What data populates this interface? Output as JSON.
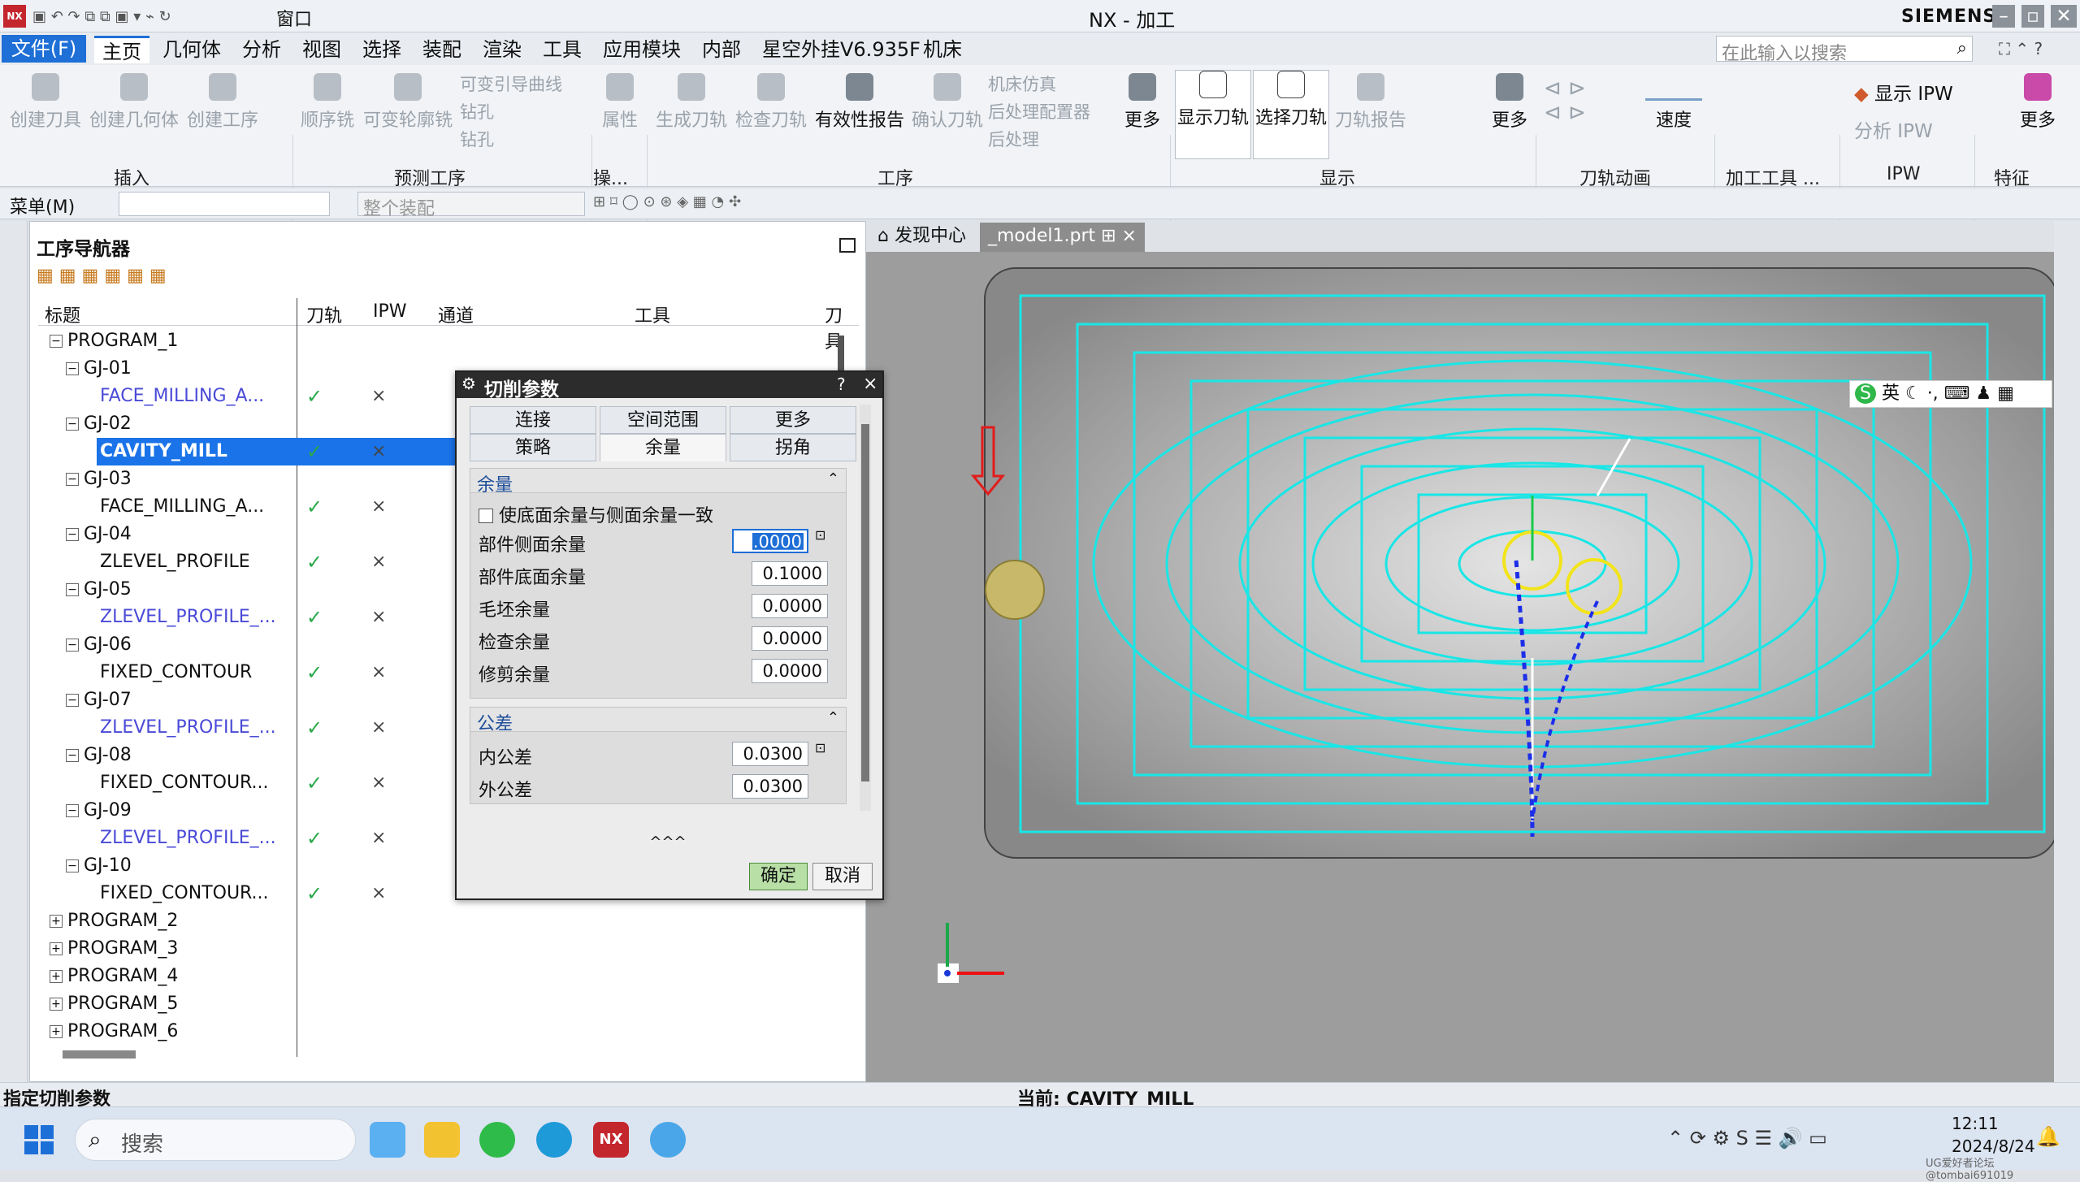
{
  "window": {
    "title": "NX - 加工",
    "brand": "SIEMENS",
    "app_badge": "NX",
    "window_menu": "窗口"
  },
  "menu": {
    "file": "文件(F)",
    "tabs": [
      "主页",
      "几何体",
      "分析",
      "视图",
      "选择",
      "装配",
      "渲染",
      "工具",
      "应用模块",
      "内部",
      "星空外挂V6.935F",
      "机床"
    ],
    "active_tab": "主页",
    "search_placeholder": "在此输入以搜索"
  },
  "ribbon": {
    "insert": {
      "buttons": [
        "创建刀具",
        "创建几何体",
        "创建工序"
      ],
      "group": "插入"
    },
    "pre": {
      "buttons": [
        "顺序铣",
        "可变轮廓铣"
      ],
      "small": [
        "可变引导曲线",
        "钻孔",
        "钻孔"
      ],
      "group": "预测工序"
    },
    "ops": {
      "attr": "属性",
      "group": "操..."
    },
    "procedure": {
      "buttons": [
        "生成刀轨",
        "检查刀轨",
        "有效性报告",
        "确认刀轨"
      ],
      "small": [
        "机床仿真",
        "后处理配置器",
        "后处理"
      ],
      "more": "更多",
      "group": "工序"
    },
    "display": {
      "buttons": [
        "显示刀轨",
        "选择刀轨",
        "刀轨报告"
      ],
      "more": "更多",
      "group": "显示"
    },
    "anim": {
      "speed": "速度",
      "group": "刀轨动画"
    },
    "tools": {
      "group": "加工工具 ..."
    },
    "ipw": {
      "show": "显示 IPW",
      "analyze": "分析 IPW",
      "group": "IPW"
    },
    "feature": {
      "more": "更多",
      "group": "特征"
    }
  },
  "cmdbar": {
    "menu": "菜单(M)",
    "filter": "整个装配"
  },
  "navigator": {
    "title": "工序导航器",
    "columns": [
      "标题",
      "刀轨",
      "IPW",
      "通道",
      "工具",
      "刀具"
    ],
    "rows": [
      {
        "label": "PROGRAM_1",
        "level": 0,
        "exp": "−",
        "tick": "",
        "x": ""
      },
      {
        "label": "GJ-01",
        "level": 1,
        "exp": "−",
        "tick": "",
        "x": ""
      },
      {
        "label": "FACE_MILLING_A...",
        "level": 2,
        "exp": "",
        "tick": "✓",
        "x": "×",
        "link": true
      },
      {
        "label": "GJ-02",
        "level": 1,
        "exp": "−",
        "tick": "",
        "x": ""
      },
      {
        "label": "CAVITY_MILL",
        "level": 2,
        "exp": "",
        "tick": "✓",
        "x": "×",
        "selected": true
      },
      {
        "label": "GJ-03",
        "level": 1,
        "exp": "−",
        "tick": "",
        "x": ""
      },
      {
        "label": "FACE_MILLING_A...",
        "level": 2,
        "exp": "",
        "tick": "✓",
        "x": "×"
      },
      {
        "label": "GJ-04",
        "level": 1,
        "exp": "−",
        "tick": "",
        "x": ""
      },
      {
        "label": "ZLEVEL_PROFILE",
        "level": 2,
        "exp": "",
        "tick": "✓",
        "x": "×"
      },
      {
        "label": "GJ-05",
        "level": 1,
        "exp": "−",
        "tick": "",
        "x": ""
      },
      {
        "label": "ZLEVEL_PROFILE_...",
        "level": 2,
        "exp": "",
        "tick": "✓",
        "x": "×",
        "link": true
      },
      {
        "label": "GJ-06",
        "level": 1,
        "exp": "−",
        "tick": "",
        "x": ""
      },
      {
        "label": "FIXED_CONTOUR",
        "level": 2,
        "exp": "",
        "tick": "✓",
        "x": "×"
      },
      {
        "label": "GJ-07",
        "level": 1,
        "exp": "−",
        "tick": "",
        "x": ""
      },
      {
        "label": "ZLEVEL_PROFILE_...",
        "level": 2,
        "exp": "",
        "tick": "✓",
        "x": "×",
        "link": true
      },
      {
        "label": "GJ-08",
        "level": 1,
        "exp": "−",
        "tick": "",
        "x": ""
      },
      {
        "label": "FIXED_CONTOUR...",
        "level": 2,
        "exp": "",
        "tick": "✓",
        "x": "×"
      },
      {
        "label": "GJ-09",
        "level": 1,
        "exp": "−",
        "tick": "",
        "x": ""
      },
      {
        "label": "ZLEVEL_PROFILE_...",
        "level": 2,
        "exp": "",
        "tick": "✓",
        "x": "×",
        "link": true
      },
      {
        "label": "GJ-10",
        "level": 1,
        "exp": "−",
        "tick": "",
        "x": ""
      },
      {
        "label": "FIXED_CONTOUR...",
        "level": 2,
        "exp": "",
        "tick": "✓",
        "x": "×"
      },
      {
        "label": "PROGRAM_2",
        "level": 0,
        "exp": "+",
        "tick": "",
        "x": ""
      },
      {
        "label": "PROGRAM_3",
        "level": 0,
        "exp": "+",
        "tick": "",
        "x": ""
      },
      {
        "label": "PROGRAM_4",
        "level": 0,
        "exp": "+",
        "tick": "",
        "x": ""
      },
      {
        "label": "PROGRAM_5",
        "level": 0,
        "exp": "+",
        "tick": "",
        "x": ""
      },
      {
        "label": "PROGRAM_6",
        "level": 0,
        "exp": "+",
        "tick": "",
        "x": ""
      }
    ]
  },
  "viewport_tabs": {
    "discovery": "发现中心",
    "model": "_model1.prt"
  },
  "dialog": {
    "title": "切削参数",
    "help": "?",
    "tabs_row1": [
      "连接",
      "空间范围",
      "更多"
    ],
    "tabs_row2": [
      "策略",
      "余量",
      "拐角"
    ],
    "active_tab": "余量",
    "section_stock": "余量",
    "checkbox": "使底面余量与侧面余量一致",
    "fields": [
      {
        "label": "部件侧面余量",
        "value": "0.0000"
      },
      {
        "label": "部件底面余量",
        "value": "0.1000"
      },
      {
        "label": "毛坯余量",
        "value": "0.0000"
      },
      {
        "label": "检查余量",
        "value": "0.0000"
      },
      {
        "label": "修剪余量",
        "value": "0.0000"
      }
    ],
    "section_tol": "公差",
    "tol_fields": [
      {
        "label": "内公差",
        "value": "0.0300"
      },
      {
        "label": "外公差",
        "value": "0.0300"
      }
    ],
    "collapse": "^^^",
    "ok": "确定",
    "cancel": "取消"
  },
  "ime": {
    "lang": "英"
  },
  "status": {
    "left": "指定切削参数",
    "current": "当前: CAVITY_MILL"
  },
  "taskbar": {
    "search": "搜索",
    "time": "12:11",
    "date": "2024/8/24",
    "watermark": "UG爱好者论坛@tombai691019"
  },
  "colors": {
    "accent": "#1e6fd6",
    "selected": "#1a73e8",
    "toolpath": "#19e6e6",
    "link": "#4a4ad8"
  }
}
